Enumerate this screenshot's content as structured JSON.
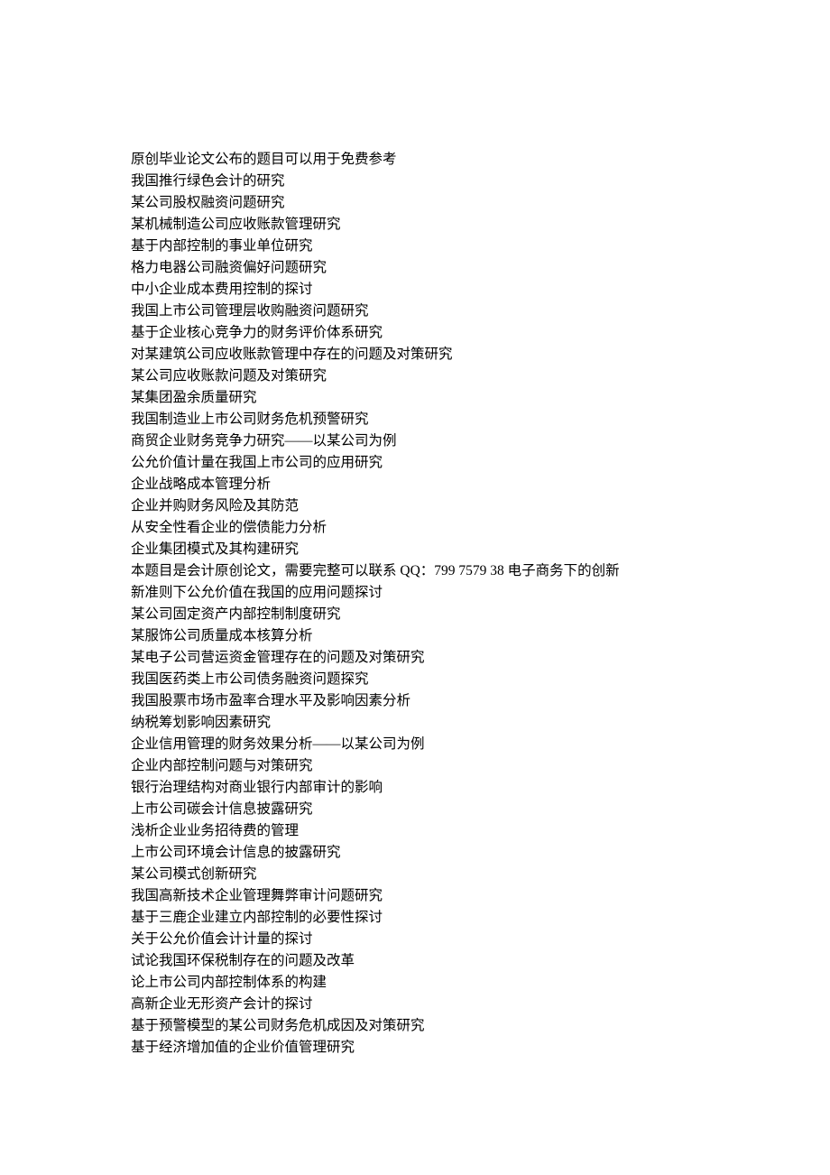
{
  "lines": [
    "原创毕业论文公布的题目可以用于免费参考",
    "我国推行绿色会计的研究",
    "某公司股权融资问题研究",
    "某机械制造公司应收账款管理研究",
    "基于内部控制的事业单位研究",
    "格力电器公司融资偏好问题研究",
    "中小企业成本费用控制的探讨",
    "我国上市公司管理层收购融资问题研究",
    "基于企业核心竞争力的财务评价体系研究",
    "对某建筑公司应收账款管理中存在的问题及对策研究",
    "某公司应收账款问题及对策研究",
    "某集团盈余质量研究",
    "我国制造业上市公司财务危机预警研究",
    "商贸企业财务竞争力研究——以某公司为例",
    "公允价值计量在我国上市公司的应用研究",
    "企业战略成本管理分析",
    "企业并购财务风险及其防范",
    "从安全性看企业的偿债能力分析",
    "企业集团模式及其构建研究",
    "本题目是会计原创论文，需要完整可以联系 QQ：799 7579 38   电子商务下的创新",
    "新准则下公允价值在我国的应用问题探讨",
    "某公司固定资产内部控制制度研究",
    "某服饰公司质量成本核算分析",
    "某电子公司营运资金管理存在的问题及对策研究",
    "我国医药类上市公司债务融资问题探究",
    "我国股票市场市盈率合理水平及影响因素分析",
    "纳税筹划影响因素研究",
    "企业信用管理的财务效果分析——以某公司为例",
    "企业内部控制问题与对策研究",
    "银行治理结构对商业银行内部审计的影响",
    "上市公司碳会计信息披露研究",
    "浅析企业业务招待费的管理",
    "上市公司环境会计信息的披露研究",
    "某公司模式创新研究",
    "我国高新技术企业管理舞弊审计问题研究",
    "基于三鹿企业建立内部控制的必要性探讨",
    "关于公允价值会计计量的探讨",
    "试论我国环保税制存在的问题及改革",
    "论上市公司内部控制体系的构建",
    "高新企业无形资产会计的探讨",
    "基于预警模型的某公司财务危机成因及对策研究",
    "基于经济增加值的企业价值管理研究"
  ]
}
